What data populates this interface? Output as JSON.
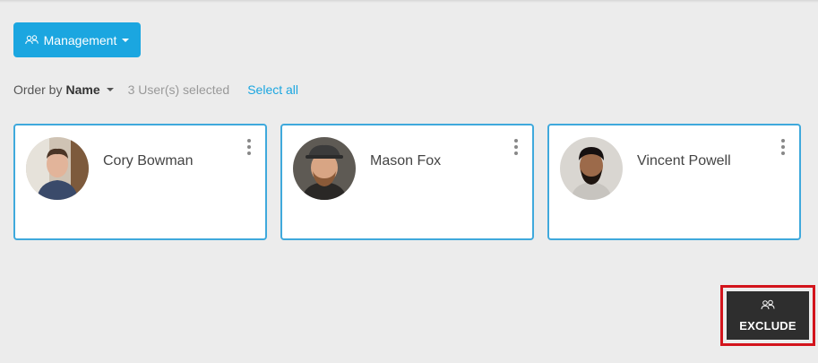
{
  "toolbar": {
    "management_label": "Management",
    "management_icon": "group-icon"
  },
  "order": {
    "label": "Order by",
    "value": "Name",
    "selected_count": "3 User(s) selected",
    "select_all": "Select all"
  },
  "users": [
    {
      "name": "Cory Bowman"
    },
    {
      "name": "Mason Fox"
    },
    {
      "name": "Vincent Powell"
    }
  ],
  "actions": {
    "exclude_label": "EXCLUDE",
    "exclude_icon": "group-icon"
  },
  "colors": {
    "accent": "#1ba6e0",
    "card_border": "#3fa9dc",
    "highlight": "#d3141c",
    "dark_button": "#2e2e2e"
  }
}
